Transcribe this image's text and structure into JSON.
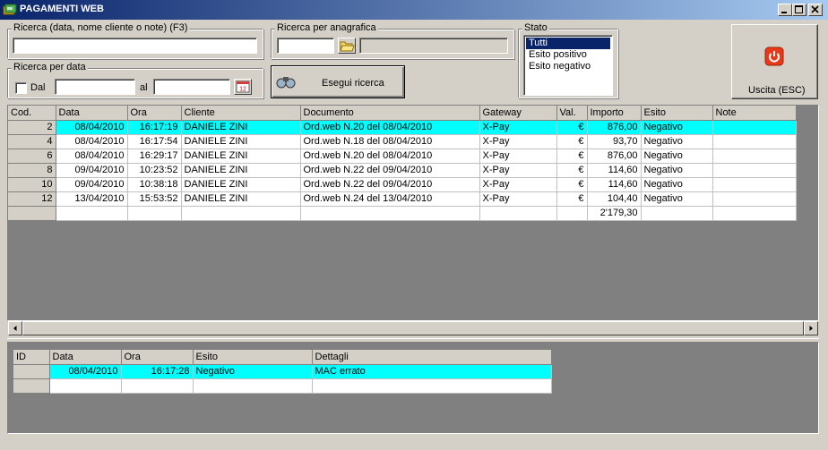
{
  "window": {
    "title": "PAGAMENTI WEB",
    "icons": [
      "app-icon",
      "minimize-icon",
      "maximize-icon",
      "close-icon"
    ]
  },
  "search": {
    "text_label": "Ricerca (data, nome cliente o note) (F3)",
    "text_value": "",
    "anagrafica_label": "Ricerca per anagrafica",
    "anagrafica_code": "",
    "anagrafica_name": "",
    "date_label": "Ricerca per data",
    "dal_label": "Dal",
    "dal_checked": false,
    "dal_value": "",
    "al_label": "al",
    "al_value": "",
    "calendar_icon_text": "12",
    "execute_label": "Esegui ricerca"
  },
  "stato": {
    "label": "Stato",
    "options": [
      "Tutti",
      "Esito positivo",
      "Esito negativo"
    ],
    "selected": "Tutti"
  },
  "exit": {
    "label": "Uscita (ESC)",
    "color": "#e83a1a"
  },
  "main_grid": {
    "columns": [
      "Cod.",
      "Data",
      "Ora",
      "Cliente",
      "Documento",
      "Gateway",
      "Val.",
      "Importo",
      "Esito",
      "Note"
    ],
    "rows": [
      [
        "2",
        "08/04/2010",
        "16:17:19",
        "DANIELE ZINI",
        "Ord.web N.20 del 08/04/2010",
        "X-Pay",
        "€",
        "876,00",
        "Negativo",
        ""
      ],
      [
        "4",
        "08/04/2010",
        "16:17:54",
        "DANIELE ZINI",
        "Ord.web N.18 del 08/04/2010",
        "X-Pay",
        "€",
        "93,70",
        "Negativo",
        ""
      ],
      [
        "6",
        "08/04/2010",
        "16:29:17",
        "DANIELE ZINI",
        "Ord.web N.20 del 08/04/2010",
        "X-Pay",
        "€",
        "876,00",
        "Negativo",
        ""
      ],
      [
        "8",
        "09/04/2010",
        "10:23:52",
        "DANIELE ZINI",
        "Ord.web N.22 del 09/04/2010",
        "X-Pay",
        "€",
        "114,60",
        "Negativo",
        ""
      ],
      [
        "10",
        "09/04/2010",
        "10:38:18",
        "DANIELE ZINI",
        "Ord.web N.22 del 09/04/2010",
        "X-Pay",
        "€",
        "114,60",
        "Negativo",
        ""
      ],
      [
        "12",
        "13/04/2010",
        "15:53:52",
        "DANIELE ZINI",
        "Ord.web N.24 del 13/04/2010",
        "X-Pay",
        "€",
        "104,40",
        "Negativo",
        ""
      ]
    ],
    "total": "2'179,30",
    "highlight_color": "#00ffff"
  },
  "detail_grid": {
    "columns": [
      "ID",
      "Data",
      "Ora",
      "Esito",
      "Dettagli"
    ],
    "rows": [
      [
        "",
        "08/04/2010",
        "16:17:28",
        "Negativo",
        "MAC errato"
      ]
    ]
  }
}
